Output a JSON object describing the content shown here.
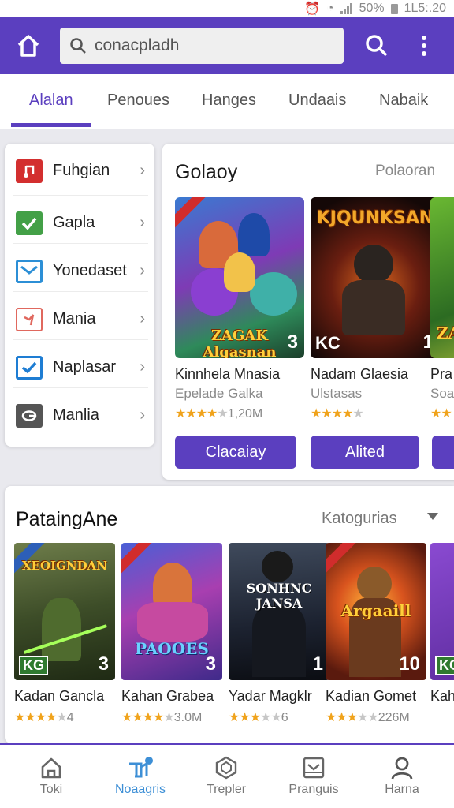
{
  "status_bar": {
    "battery": "50%",
    "time": "1L5:.20"
  },
  "search": {
    "query": "conacpladh"
  },
  "tabs": [
    {
      "label": "Alalan",
      "active": true
    },
    {
      "label": "Penoues",
      "active": false
    },
    {
      "label": "Hanges",
      "active": false
    },
    {
      "label": "Undaais",
      "active": false
    },
    {
      "label": "Nabaik",
      "active": false
    }
  ],
  "menu": [
    {
      "label": "Fuhgian",
      "icon": "music-app-icon",
      "color": "#d32f2f"
    },
    {
      "label": "Gapla",
      "icon": "checkmark-app-icon",
      "color": "#43a047"
    },
    {
      "label": "Yonedaset",
      "icon": "mail-app-icon",
      "color": "#2c8fd6"
    },
    {
      "label": "Mania",
      "icon": "flag-app-icon",
      "color": "#e0685e"
    },
    {
      "label": "Naplasar",
      "icon": "checkbox-app-icon",
      "color": "#1e7dd3"
    },
    {
      "label": "Manlia",
      "icon": "swirl-app-icon",
      "color": "#555555"
    }
  ],
  "featured": {
    "title": "Golaoy",
    "link": "Polaoran",
    "games": [
      {
        "thumb_title": "ZAGAK Algasnan",
        "num": "3",
        "code": "",
        "name": "Kinnhela Mnasia",
        "sub": "Epelade Galka",
        "rating": 4,
        "rating_text": "1,20M",
        "button": "Clacaiay"
      },
      {
        "thumb_title": "KJQUNKSAN",
        "num": "1",
        "code": "KC",
        "name": "Nadam Glaesia",
        "sub": "Ulstasas",
        "rating": 4,
        "rating_text": "",
        "button": "Alited"
      },
      {
        "thumb_title": "ZA",
        "num": "",
        "code": "",
        "name": "Pra",
        "sub": "Soa",
        "rating": 2,
        "rating_text": "",
        "button": ""
      }
    ]
  },
  "section2": {
    "title": "PataingAne",
    "filter": "Katogurias",
    "games": [
      {
        "thumb_title": "XEOIGNDAN",
        "num": "3",
        "code": "KG",
        "name": "Kadan Gancla",
        "rating": 4,
        "rating_text": "4"
      },
      {
        "thumb_title": "PAOOES",
        "num": "3",
        "code": "",
        "name": "Kahan Grabea",
        "rating": 4,
        "rating_text": "3.0M"
      },
      {
        "thumb_title": "SONHNC JANSA",
        "num": "1",
        "code": "",
        "name": "Yadar Magklr",
        "rating": 3,
        "rating_text": "6"
      },
      {
        "thumb_title": "Argaaill",
        "num": "10",
        "code": "",
        "name": "Kadian Gomet",
        "rating": 3,
        "rating_text": "226M"
      },
      {
        "thumb_title": "",
        "num": "",
        "code": "KG",
        "name": "Kah",
        "rating": 0,
        "rating_text": ""
      }
    ]
  },
  "bottom_nav": [
    {
      "label": "Toki",
      "icon": "home-icon",
      "active": false
    },
    {
      "label": "Noaagris",
      "icon": "apps-icon",
      "active": true
    },
    {
      "label": "Trepler",
      "icon": "shield-icon",
      "active": false
    },
    {
      "label": "Pranguis",
      "icon": "inbox-icon",
      "active": false
    },
    {
      "label": "Harna",
      "icon": "profile-icon",
      "active": false
    }
  ],
  "colors": {
    "accent": "#5b3fbf",
    "star": "#f0a31c",
    "nav_active": "#3d8fd6"
  }
}
